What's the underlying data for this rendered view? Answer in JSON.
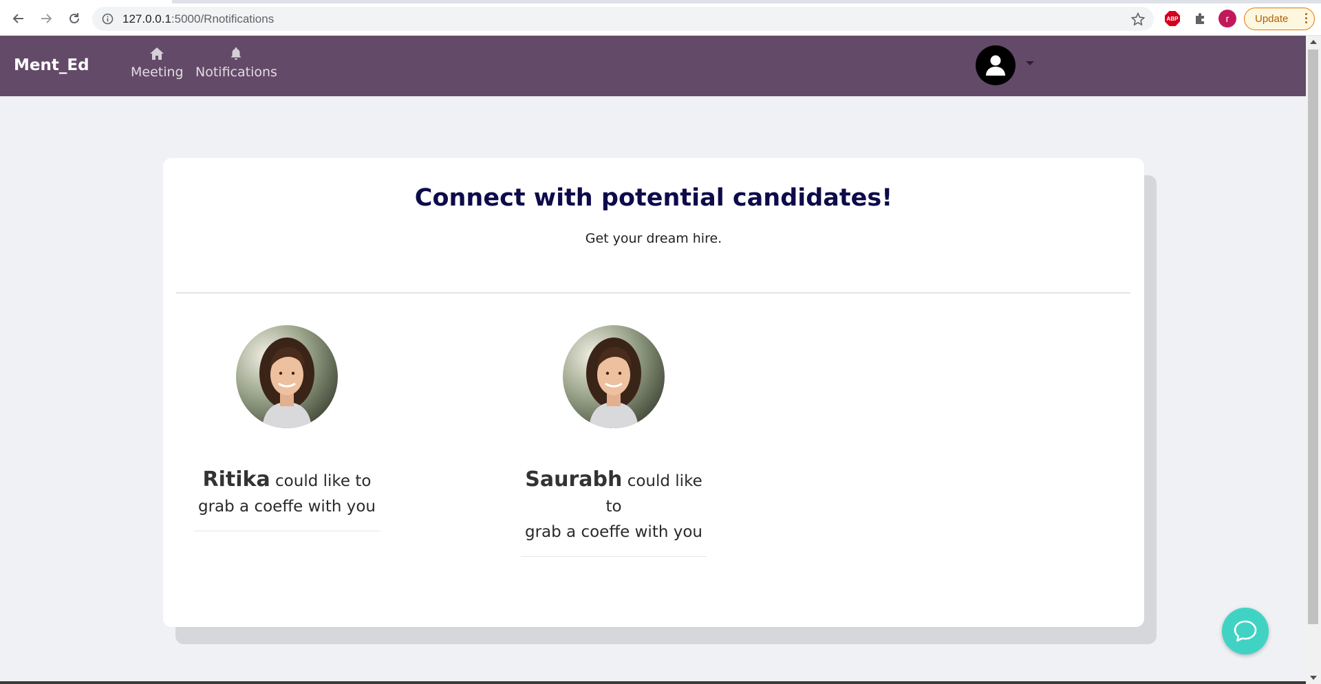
{
  "browser": {
    "url_host": "127.0.0.1",
    "url_rest": ":5000/Rnotifications",
    "extension_abp_label": "ABP",
    "profile_initial": "r",
    "update_label": "Update"
  },
  "navbar": {
    "brand": "Ment_Ed",
    "items": [
      {
        "label": "Meeting",
        "icon": "home-icon"
      },
      {
        "label": "Notifications",
        "icon": "bell-icon"
      }
    ]
  },
  "main": {
    "title": "Connect with potential candidates!",
    "subtitle": "Get your dream hire.",
    "notifications": [
      {
        "name": "Ritika",
        "message_line1": "could like to",
        "message_line2": "grab a coeffe with you"
      },
      {
        "name": "Saurabh",
        "message_line1": "could like to",
        "message_line2": "grab a coeffe with you"
      }
    ]
  },
  "colors": {
    "navbar": "#634a68",
    "title": "#0d0b4a",
    "chat_fab": "#40d3c4",
    "page_bg": "#f0f1f4"
  }
}
